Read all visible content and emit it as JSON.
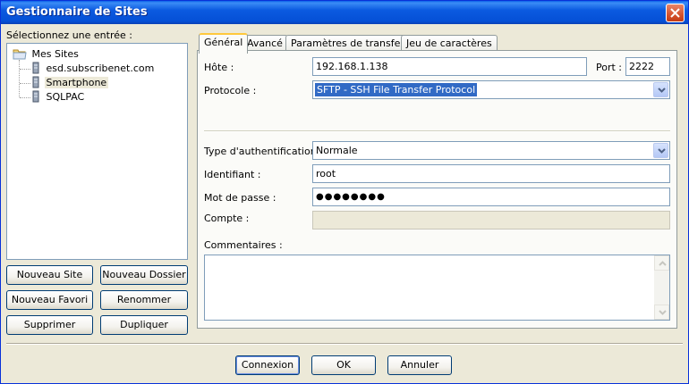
{
  "window": {
    "title": "Gestionnaire de Sites"
  },
  "sites": {
    "label": "Sélectionnez une entrée :",
    "root": "Mes Sites",
    "items": [
      "esd.subscribenet.com",
      "Smartphone",
      "SQLPAC"
    ],
    "selected": "Smartphone"
  },
  "buttons": {
    "new_site": "Nouveau Site",
    "new_folder": "Nouveau Dossier",
    "new_bookmark": "Nouveau Favori",
    "rename": "Renommer",
    "delete": "Supprimer",
    "duplicate": "Dupliquer",
    "connect": "Connexion",
    "ok": "OK",
    "cancel": "Annuler"
  },
  "tabs": [
    "Général",
    "Avancé",
    "Paramètres de transfert",
    "Jeu de caractères"
  ],
  "general": {
    "host_label": "Hôte :",
    "host_value": "192.168.1.138",
    "port_label": "Port :",
    "port_value": "2222",
    "protocol_label": "Protocole :",
    "protocol_value": "SFTP - SSH File Transfer Protocol",
    "auth_label": "Type d'authentification :",
    "auth_value": "Normale",
    "user_label": "Identifiant :",
    "user_value": "root",
    "password_label": "Mot de passe :",
    "password_value": "●●●●●●●●",
    "account_label": "Compte :",
    "account_value": "",
    "comments_label": "Commentaires :",
    "comments_value": ""
  },
  "colors": {
    "titlebar": "#0550d6",
    "selection": "#316ac5",
    "tab_highlight": "#ffc83c"
  }
}
